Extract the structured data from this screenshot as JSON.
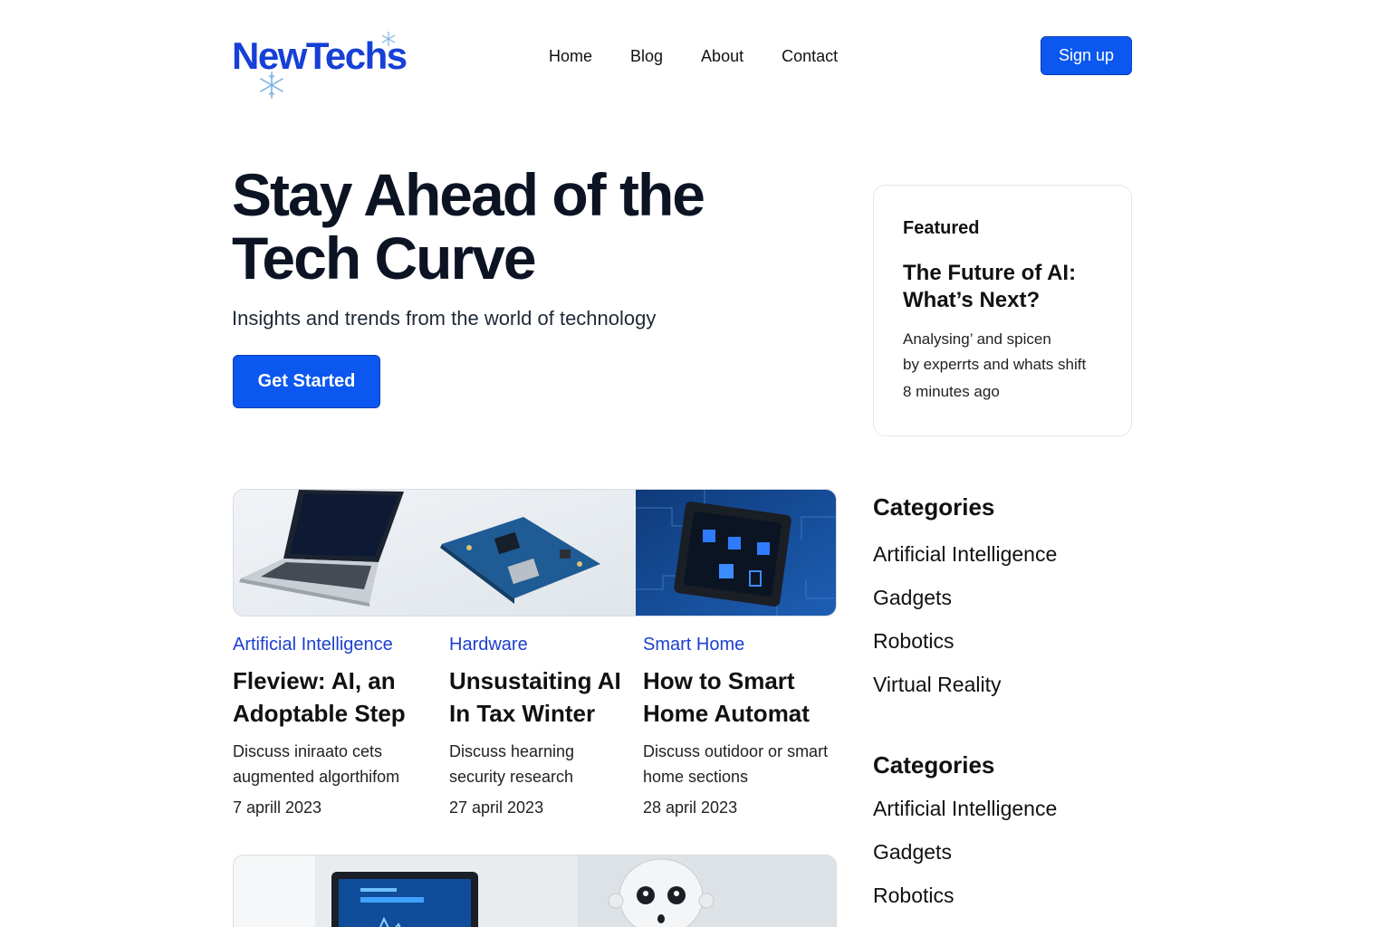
{
  "brand": {
    "name": "NewTechs",
    "color": "#1640d6"
  },
  "nav": {
    "items": [
      "Home",
      "Blog",
      "About",
      "Contact"
    ]
  },
  "header": {
    "signup_label": "Sign up"
  },
  "hero": {
    "title": "Stay Ahead of the Tech Curve",
    "subtitle": "Insights and trends from the world of technology",
    "cta_label": "Get Started"
  },
  "featured": {
    "label": "Featured",
    "title": "The Future of AI: What’s Next?",
    "desc_line1": "Analysing’ and spicen",
    "desc_line2": "by experrts and whats shift",
    "time": "8 minutes ago"
  },
  "articles": [
    {
      "category": "Artificial Intelligence",
      "title": "Fleview: AI, an Adoptable Step",
      "desc": "Discuss iniraato cets augmented algorthifom",
      "date": "7 aprill 2023"
    },
    {
      "category": "Hardware",
      "title": "Unsustaiting AI In Tax Winter",
      "desc": "Discuss hearning security research",
      "date": "27 april 2023"
    },
    {
      "category": "Smart Home",
      "title": "How to Smart Home Automat",
      "desc": "Discuss outidoor or smart home sections",
      "date": "28 april 2023"
    }
  ],
  "sidebar": {
    "categories_1": {
      "title": "Categories",
      "items": [
        "Artificial Intelligence",
        "Gadgets",
        "Robotics",
        "Virtual Reality"
      ]
    },
    "categories_2": {
      "title": "Categories",
      "items": [
        "Artificial Intelligence",
        "Gadgets",
        "Robotics"
      ]
    }
  },
  "colors": {
    "accent": "#0b57f0",
    "category_link": "#1d3fd1",
    "heading": "#0c1424"
  }
}
